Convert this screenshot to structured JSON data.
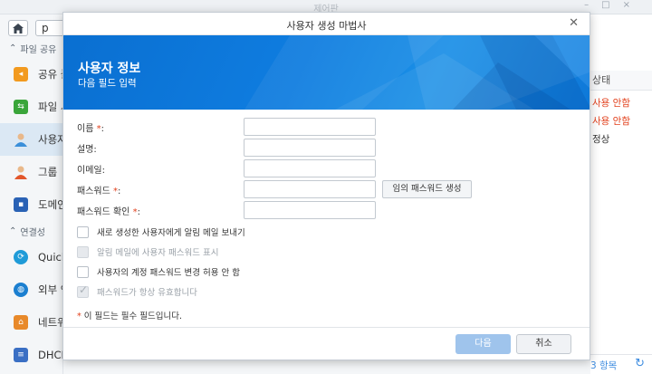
{
  "app": {
    "title": "제어판"
  },
  "sidebar": {
    "search_value": "p",
    "sections": [
      {
        "label": "파일 공유"
      },
      {
        "label": "연결성"
      }
    ],
    "items": [
      {
        "label": "공유 폴더",
        "icon": "shared-folder-icon",
        "color": "#f29a1f"
      },
      {
        "label": "파일 서비스",
        "icon": "file-services-icon",
        "color": "#3aa53a"
      },
      {
        "label": "사용자",
        "icon": "user-icon",
        "color": "#3b8fd9",
        "active": true
      },
      {
        "label": "그룹",
        "icon": "group-icon",
        "color": "#e2562b"
      },
      {
        "label": "도메인/LDAP",
        "icon": "domain-icon",
        "color": "#2a62b5"
      },
      {
        "label": "QuickConnect",
        "icon": "quickconnect-icon",
        "color": "#1f9bd8"
      },
      {
        "label": "외부 액세스",
        "icon": "globe-icon",
        "color": "#1b7fd0"
      },
      {
        "label": "네트워크",
        "icon": "network-icon",
        "color": "#e8892a"
      },
      {
        "label": "DHCP Server",
        "icon": "dhcp-icon",
        "color": "#3a6fc4"
      }
    ]
  },
  "right_panel": {
    "header": "상태",
    "rows": [
      {
        "text": "사용 안함",
        "color": "#e2401c"
      },
      {
        "text": "사용 안함",
        "color": "#e2401c"
      },
      {
        "text": "정상",
        "color": "#333333"
      }
    ],
    "count": "3 항목"
  },
  "dialog": {
    "title": "사용자 생성 마법사",
    "banner_title": "사용자 정보",
    "banner_subtitle": "다음 필드 입력",
    "fields": [
      {
        "label": "이름",
        "required": true,
        "value": ""
      },
      {
        "label": "설명",
        "required": false,
        "value": ""
      },
      {
        "label": "이메일",
        "required": false,
        "value": ""
      },
      {
        "label": "패스워드",
        "required": true,
        "value": ""
      },
      {
        "label": "패스워드 확인",
        "required": true,
        "value": ""
      }
    ],
    "required_mark": "*",
    "generate_password_label": "임의 패스워드 생성",
    "checkboxes": [
      {
        "label": "새로 생성한 사용자에게 알림 메일 보내기",
        "checked": false,
        "disabled": false
      },
      {
        "label": "알림 메일에 사용자 패스워드 표시",
        "checked": false,
        "disabled": true
      },
      {
        "label": "사용자의 계정 패스워드 변경 허용 안 함",
        "checked": false,
        "disabled": false
      },
      {
        "label": "패스워드가 항상 유효합니다",
        "checked": true,
        "disabled": true
      }
    ],
    "required_note": "이 필드는 필수 필드입니다.",
    "next_label": "다음",
    "cancel_label": "취소"
  }
}
